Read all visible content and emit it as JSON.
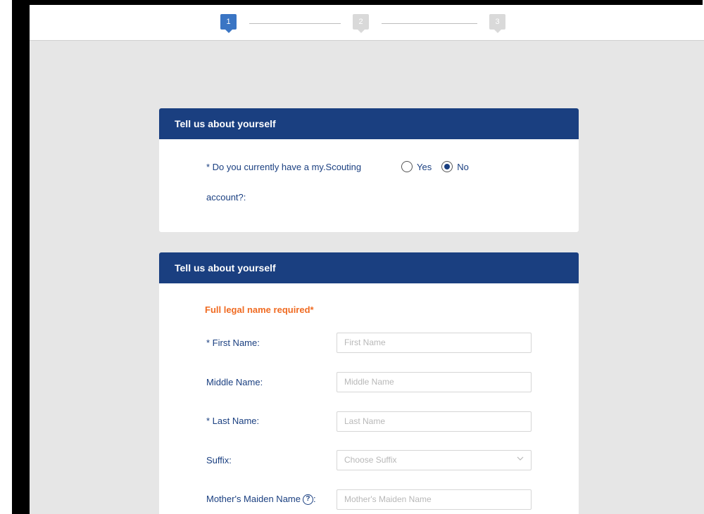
{
  "stepper": {
    "steps": [
      {
        "label": "1",
        "state": "active"
      },
      {
        "label": "2",
        "state": "inactive"
      },
      {
        "label": "3",
        "state": "inactive"
      }
    ]
  },
  "account_card": {
    "header": "Tell us about yourself",
    "question_line1": "* Do you currently have a my.Scouting",
    "question_line2": "account?:",
    "options": [
      {
        "label": "Yes",
        "checked": false
      },
      {
        "label": "No",
        "checked": true
      }
    ]
  },
  "name_card": {
    "header": "Tell us about yourself",
    "notice": "Full legal name required*",
    "fields": {
      "first": {
        "label": "* First Name:",
        "placeholder": "First Name"
      },
      "middle": {
        "label": "Middle Name:",
        "placeholder": "Middle Name"
      },
      "last": {
        "label": "* Last Name:",
        "placeholder": "Last Name"
      },
      "suffix": {
        "label": "Suffix:",
        "placeholder": "Choose Suffix"
      },
      "maiden": {
        "label": "Mother's Maiden Name",
        "label_suffix": ":",
        "placeholder": "Mother's Maiden Name"
      }
    }
  },
  "colors": {
    "header_bg": "#1a3f80",
    "step_active": "#3a75c4",
    "notice": "#f06b22"
  }
}
